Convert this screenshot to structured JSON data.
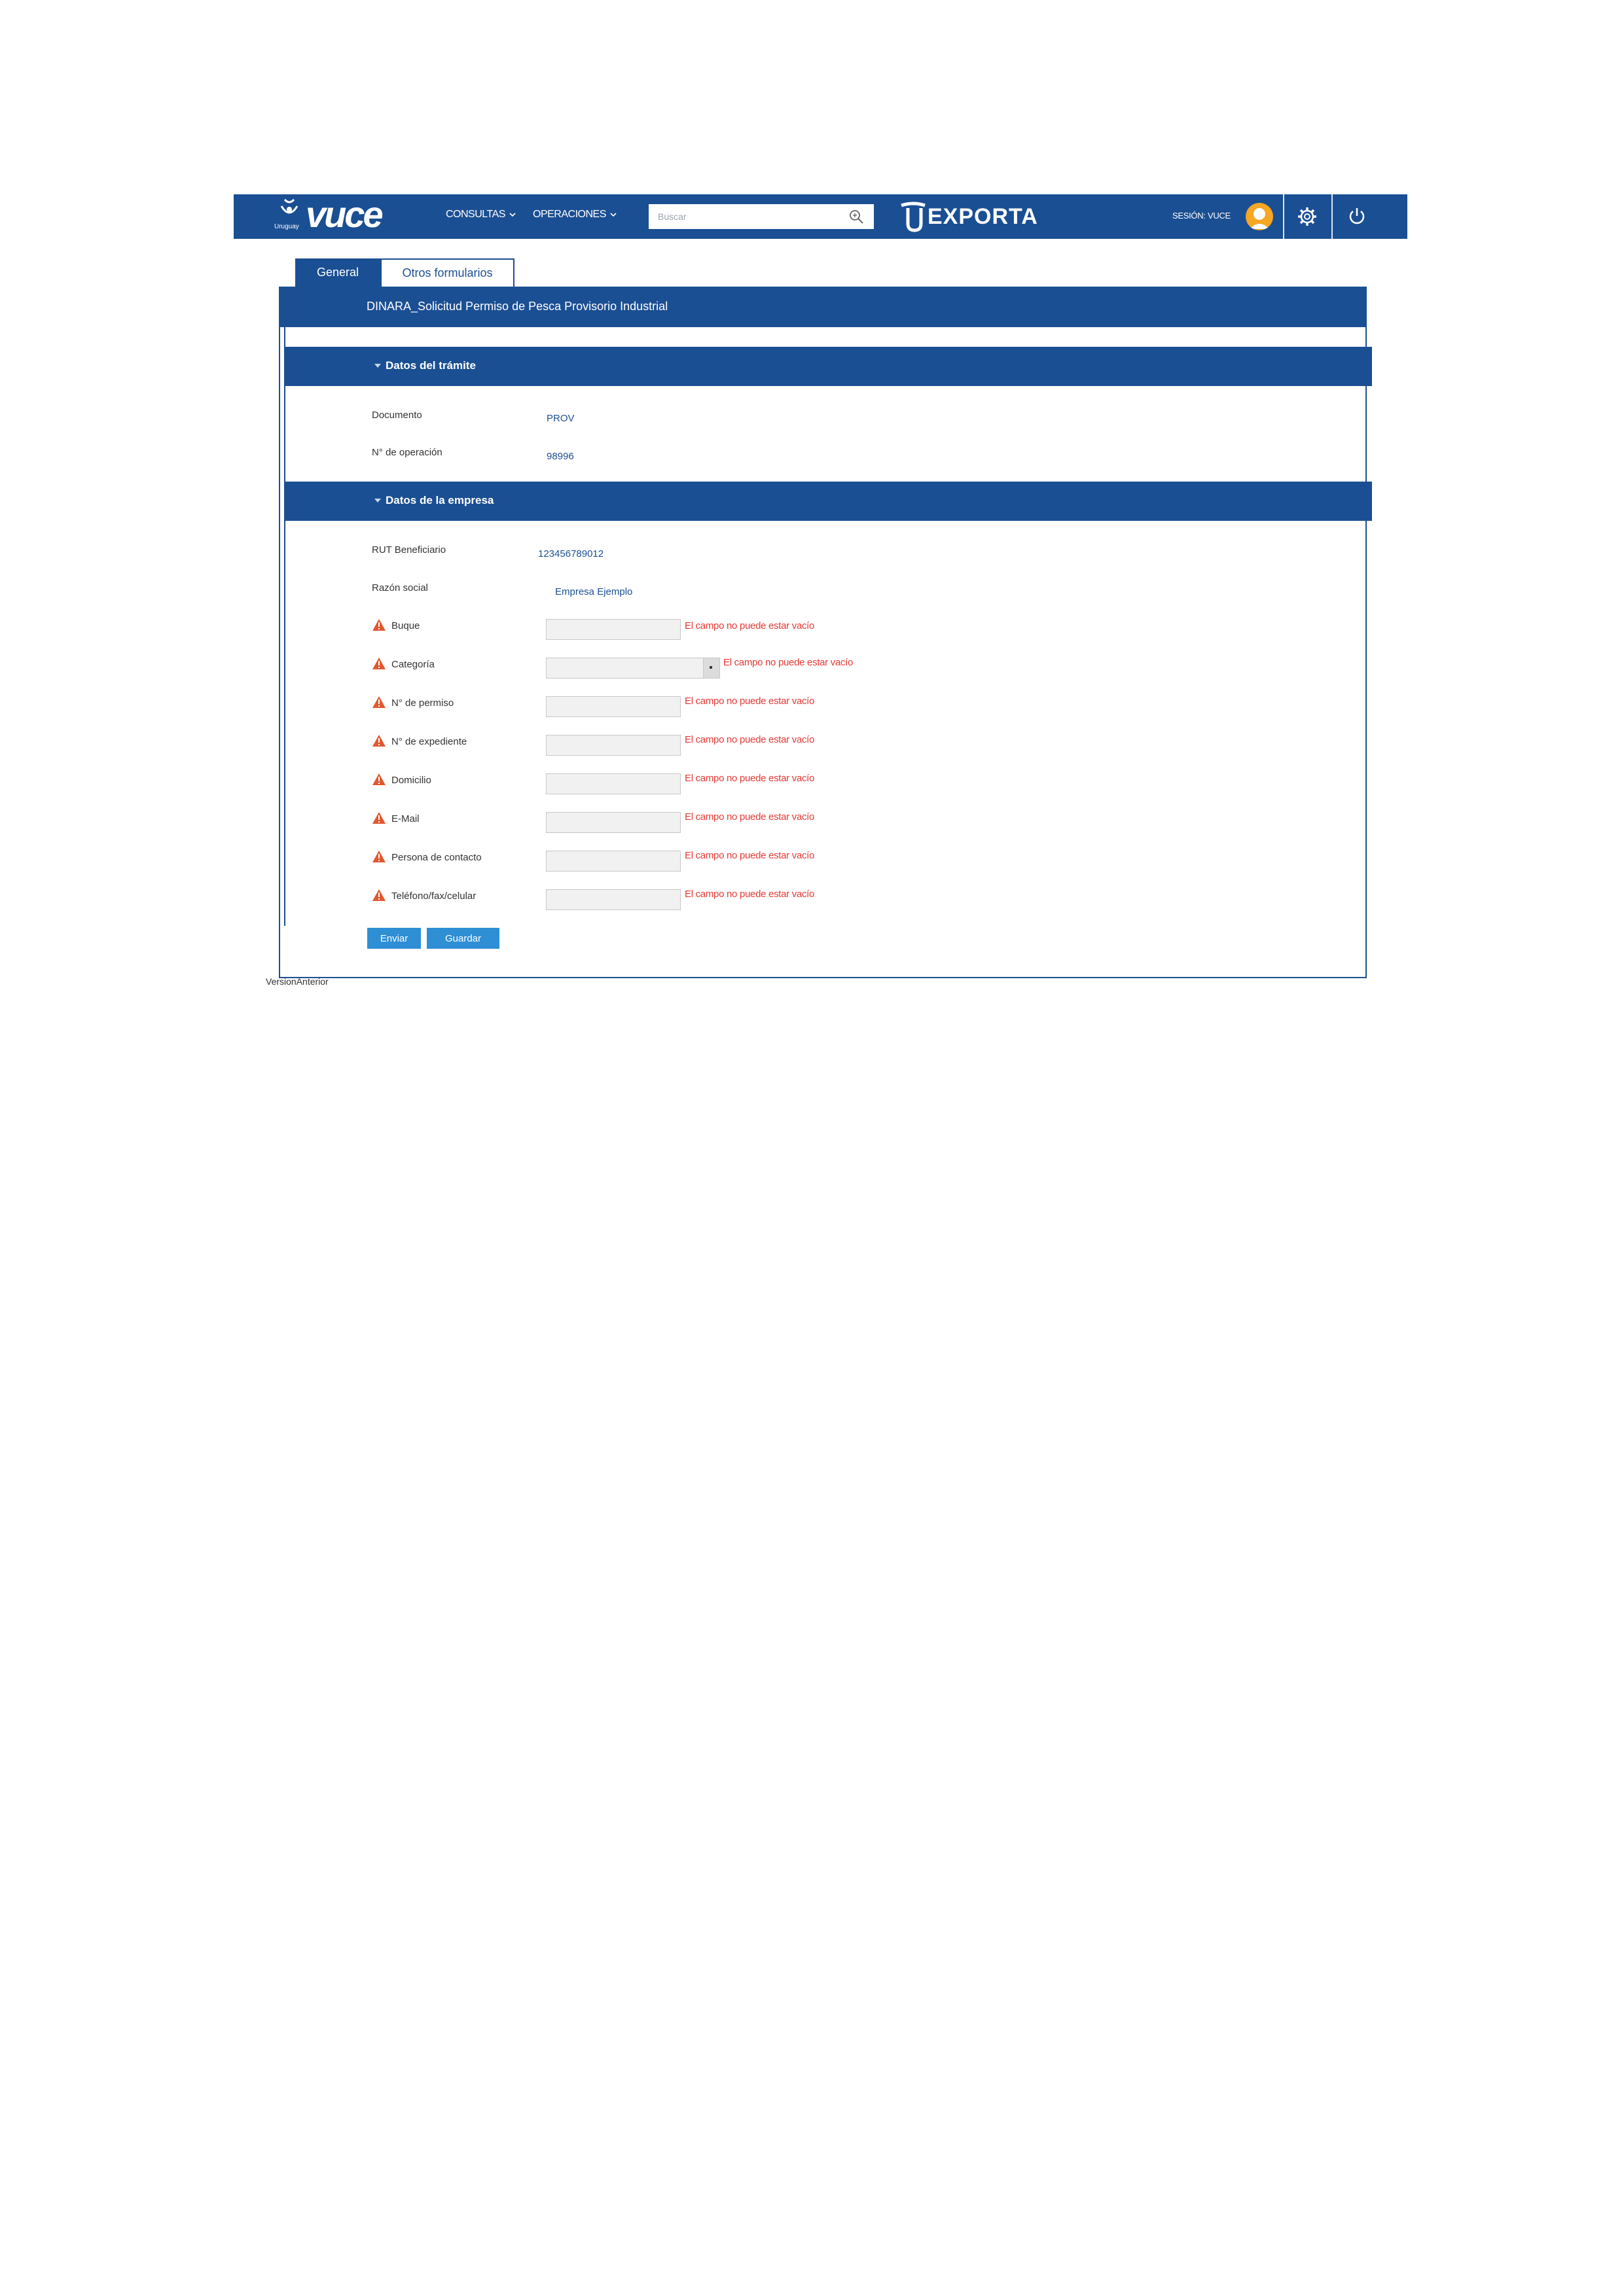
{
  "header": {
    "logo_text": "vuce",
    "logo_country": "Uruguay",
    "nav": [
      {
        "label": "CONSULTAS"
      },
      {
        "label": "OPERACIONES"
      }
    ],
    "search": {
      "placeholder": "Buscar",
      "value": ""
    },
    "brand2_text": "EXPORTA",
    "session_label": "SESIÓN: VUCE"
  },
  "tabs": [
    {
      "label": "General",
      "active": true
    },
    {
      "label": "Otros formularios",
      "active": false
    }
  ],
  "form": {
    "title": "DINARA_Solicitud Permiso de Pesca Provisorio Industrial",
    "sections": [
      {
        "title": "Datos del trámite",
        "fields": [
          {
            "label": "Documento",
            "value": "PROV"
          },
          {
            "label": "N° de operación",
            "value": "98996"
          }
        ]
      },
      {
        "title": "Datos de la empresa",
        "fields": [
          {
            "label": "RUT Beneficiario",
            "value": "123456789012"
          },
          {
            "label": "Razón social",
            "value": "Empresa Ejemplo"
          }
        ],
        "required_fields": [
          {
            "label": "Buque",
            "type": "text",
            "value": "",
            "error": "El campo no puede estar vacío"
          },
          {
            "label": "Categoría",
            "type": "select",
            "value": "",
            "error": "El campo no puede estar vacío"
          },
          {
            "label": "N° de permiso",
            "type": "text",
            "value": "",
            "error": "El campo no puede estar vacío"
          },
          {
            "label": "N° de expediente",
            "type": "text",
            "value": "",
            "error": "El campo no puede estar vacío"
          },
          {
            "label": "Domicilio",
            "type": "text",
            "value": "",
            "error": "El campo no puede estar vacío"
          },
          {
            "label": "E-Mail",
            "type": "text",
            "value": "",
            "error": "El campo no puede estar vacío"
          },
          {
            "label": "Persona de contacto",
            "type": "text",
            "value": "",
            "error": "El campo no puede estar vacío"
          },
          {
            "label": "Teléfono/fax/celular",
            "type": "text",
            "value": "",
            "error": "El campo no puede estar vacío"
          }
        ]
      }
    ],
    "buttons": {
      "send": "Enviar",
      "save": "Guardar"
    }
  },
  "footer": {
    "version_link": "VersionAnterior"
  },
  "colors": {
    "primary": "#1b4f93",
    "button": "#2e8fd5",
    "error": "#e53935",
    "avatar": "#f5a623"
  }
}
